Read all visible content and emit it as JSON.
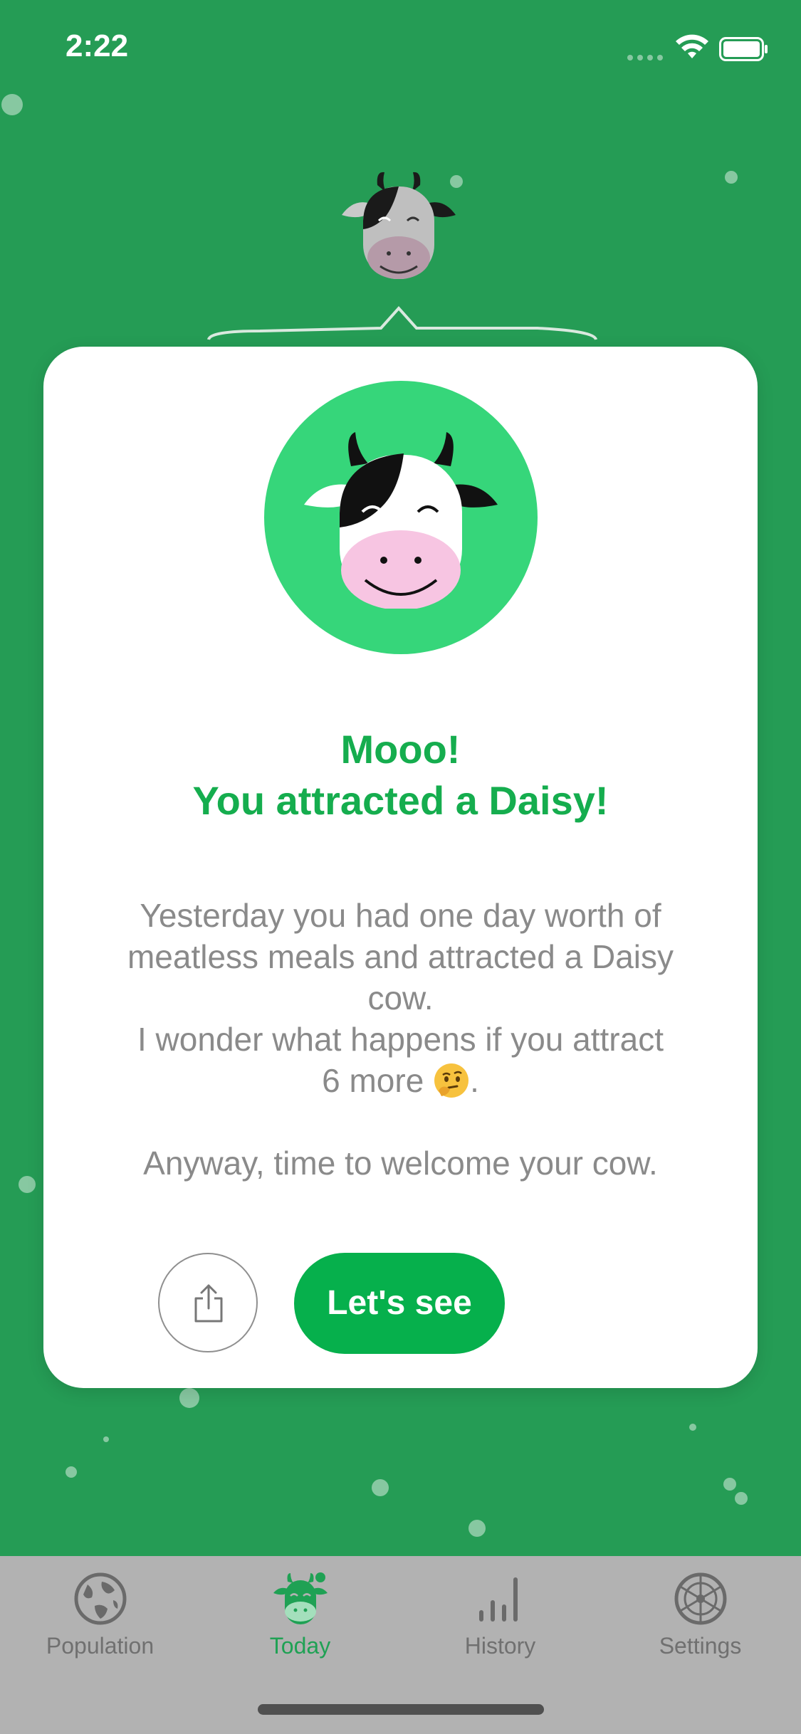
{
  "status_bar": {
    "time": "2:22",
    "icons": [
      "signal-icon",
      "wifi-icon",
      "battery-icon"
    ]
  },
  "card": {
    "title_line1": "Mooo!",
    "title_line2": "You attracted a Daisy!",
    "body_line1": "Yesterday you had one day worth of",
    "body_line2": "meatless meals and attracted a Daisy",
    "body_line3": "cow.",
    "body_line4": "I wonder what happens if you attract",
    "body_line5_text": "6 more",
    "body_line5_suffix": ".",
    "body_emoji": "thinking-face-emoji",
    "body_line6": "Anyway, time to welcome your cow.",
    "share_icon": "share-icon",
    "primary_button_label": "Let's see"
  },
  "tab_bar": {
    "tabs": [
      {
        "label": "Population",
        "icon": "globe-icon",
        "active": false
      },
      {
        "label": "Today",
        "icon": "cow-icon",
        "active": true
      },
      {
        "label": "History",
        "icon": "bar-chart-icon",
        "active": false
      },
      {
        "label": "Settings",
        "icon": "wheel-icon",
        "active": false
      }
    ]
  },
  "colors": {
    "background": "#259c55",
    "accent": "#06b04c",
    "title_green": "#15ad4e",
    "badge_green": "#36d67a",
    "tab_bar": "#b2b2b2",
    "body_text": "#8a8a8a"
  }
}
